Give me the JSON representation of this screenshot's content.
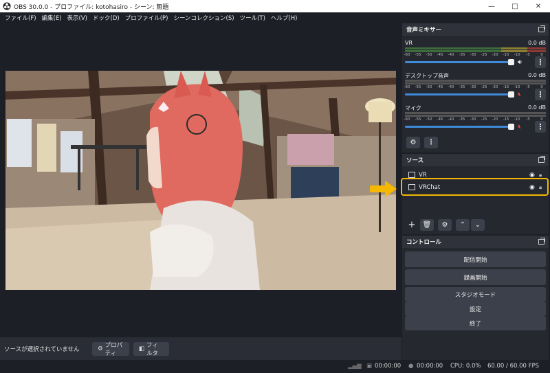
{
  "window": {
    "title": "OBS 30.0.0 - プロファイル: kotohasiro - シーン: 無題"
  },
  "menu": [
    "ファイル(F)",
    "編集(E)",
    "表示(V)",
    "ドック(D)",
    "プロファイル(P)",
    "シーンコレクション(S)",
    "ツール(T)",
    "ヘルプ(H)"
  ],
  "mixer": {
    "title": "音声ミキサー",
    "ticks": [
      "-60",
      "-55",
      "-50",
      "-45",
      "-40",
      "-35",
      "-30",
      "-25",
      "-20",
      "-15",
      "-10",
      "-5",
      "0"
    ],
    "channels": [
      {
        "name": "VR",
        "db": "0.0 dB",
        "muted": false
      },
      {
        "name": "デスクトップ音声",
        "db": "0.0 dB",
        "muted": true
      },
      {
        "name": "マイク",
        "db": "0.0 dB",
        "muted": true
      }
    ]
  },
  "sources": {
    "title": "ソース",
    "items": [
      {
        "label": "VR"
      },
      {
        "label": "VRChat"
      }
    ]
  },
  "controls": {
    "title": "コントロール",
    "buttons": [
      "配信開始",
      "録画開始",
      "スタジオモード",
      "設定",
      "終了"
    ]
  },
  "context": {
    "no_source": "ソースが選択されていません",
    "properties": "プロパティ",
    "filters": "フィルタ"
  },
  "status": {
    "stream_time": "00:00:00",
    "rec_time": "00:00:00",
    "cpu": "CPU: 0.0%",
    "fps": "60.00 / 60.00 FPS"
  },
  "colors": {
    "accent": "#3f8bd9",
    "highlight": "#f5b800",
    "mute": "#e0453a"
  }
}
